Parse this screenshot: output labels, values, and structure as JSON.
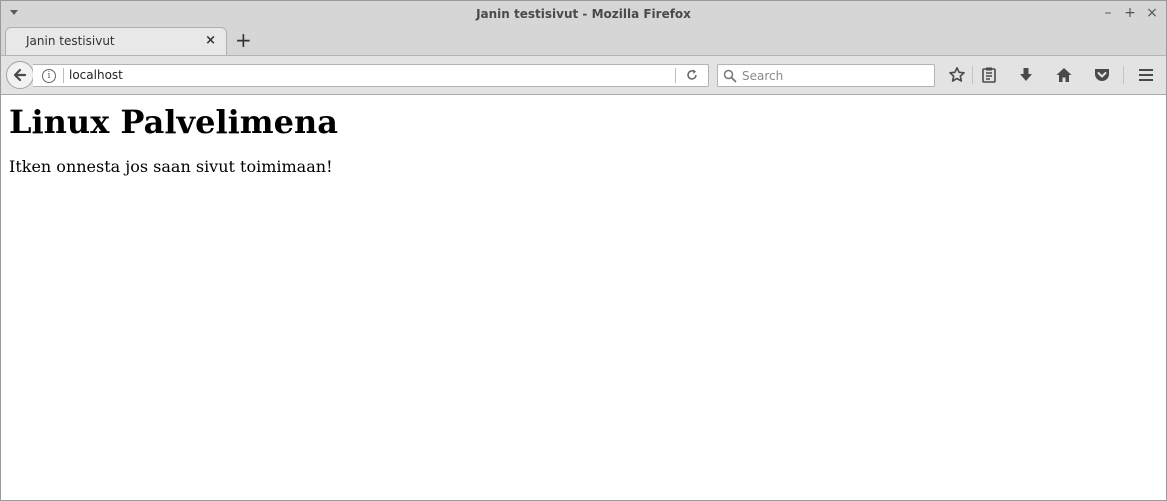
{
  "window": {
    "title": "Janin testisivut - Mozilla Firefox",
    "controls": [
      "minimize-icon",
      "maximize-icon",
      "close-icon"
    ]
  },
  "tabs": [
    {
      "label": "Janin testisivut",
      "active": true
    }
  ],
  "navbar": {
    "url": "localhost",
    "search_placeholder": "Search",
    "icons": [
      "back-icon",
      "info-icon",
      "reload-icon",
      "search-icon",
      "bookmark-star-icon",
      "reading-list-icon",
      "download-icon",
      "home-icon",
      "pocket-icon",
      "menu-icon"
    ]
  },
  "page": {
    "heading": "Linux Palvelimena",
    "paragraph": "Itken onnesta jos saan sivut toimimaan!"
  },
  "colors": {
    "chrome_bg": "#d6d6d6",
    "toolbar_bg": "#e3e3e3",
    "icon": "#4a4a4a"
  }
}
